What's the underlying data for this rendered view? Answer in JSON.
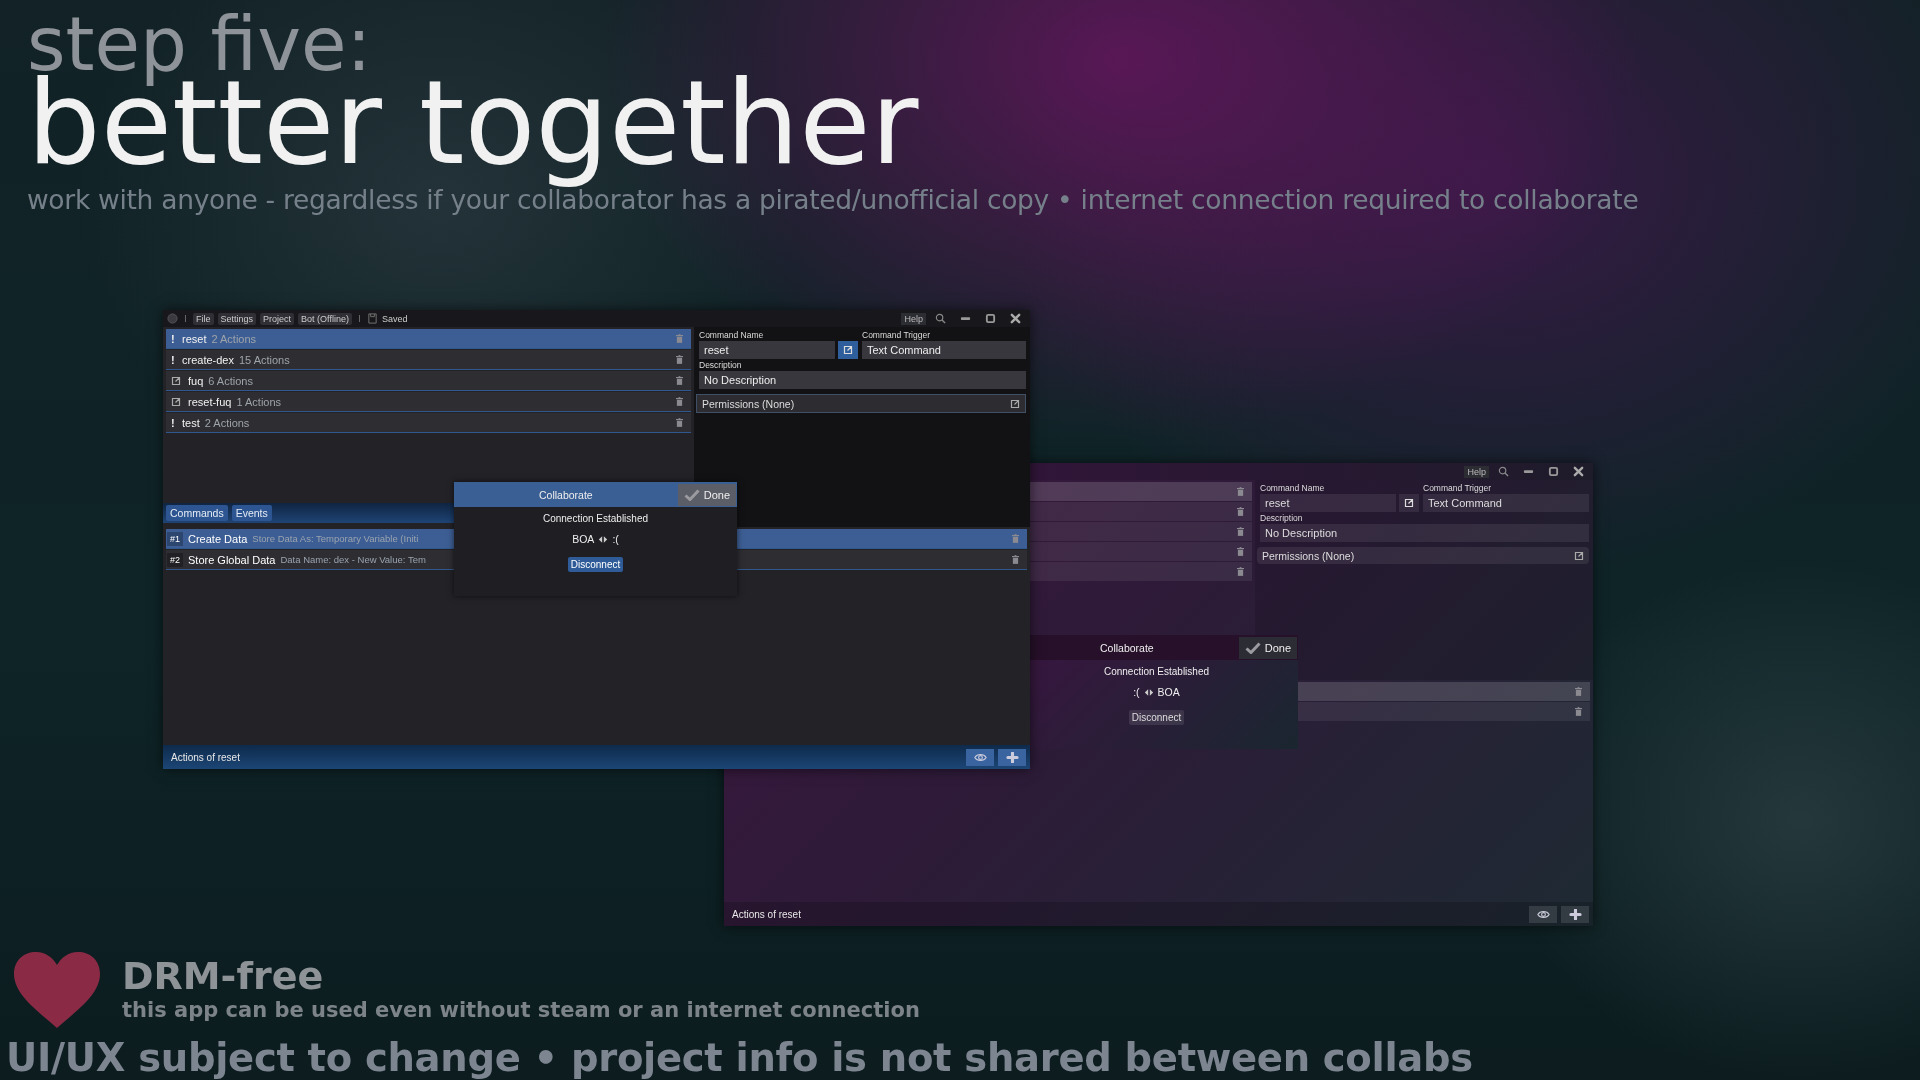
{
  "heading": {
    "kicker": "step five:",
    "title": "better together",
    "subtitle": "work with anyone - regardless if your collaborator has a pirated/unofficial copy • internet connection required to collaborate"
  },
  "windows": [
    {
      "kind": "classic",
      "menu": [
        "File",
        "Settings",
        "Project",
        "Bot (Offline)"
      ],
      "status": "Saved",
      "help": "Help",
      "commands": [
        {
          "kind": "command",
          "marker": "!",
          "name": "reset",
          "count": "2 Actions",
          "selected": true
        },
        {
          "kind": "command",
          "marker": "!",
          "name": "create-dex",
          "count": "15 Actions",
          "selected": false
        },
        {
          "kind": "event",
          "name": "fuq",
          "count": "6 Actions",
          "selected": false
        },
        {
          "kind": "event",
          "name": "reset-fuq",
          "count": "1 Actions",
          "selected": false
        },
        {
          "kind": "command",
          "marker": "!",
          "name": "test",
          "count": "2 Actions",
          "selected": false
        }
      ],
      "tabs": [
        "Commands",
        "Events"
      ],
      "form": {
        "name_label": "Command Name",
        "name": "reset",
        "trigger_label": "Command Trigger",
        "trigger": "Text Command",
        "description_label": "Description",
        "description": "No Description",
        "permissions": "Permissions (None)"
      },
      "actions": [
        {
          "number": "#1",
          "name": "Create Data",
          "detail": "Store Data As: Temporary Variable (Initi",
          "selected": true
        },
        {
          "number": "#2",
          "name": "Store Global Data",
          "detail": "Data Name: dex - New Value: Tem",
          "selected": false
        }
      ],
      "footer": "Actions of reset",
      "collab": {
        "title": "Collaborate",
        "done": "Done",
        "status": "Connection Established",
        "left": "BOA",
        "right": ":(",
        "button": "Disconnect"
      }
    },
    {
      "kind": "tinted",
      "help": "Help",
      "commands": [
        {
          "selected": true
        },
        {
          "selected": false
        },
        {
          "selected": false
        },
        {
          "selected": false
        },
        {
          "selected": false
        }
      ],
      "form": {
        "name_label": "Command Name",
        "name": "reset",
        "trigger_label": "Command Trigger",
        "trigger": "Text Command",
        "description_label": "Description",
        "description": "No Description",
        "permissions": "Permissions (None)"
      },
      "actions": [
        {
          "selected": true
        },
        {
          "selected": false
        }
      ],
      "footer": "Actions of reset",
      "collab": {
        "title": "Collaborate",
        "done": "Done",
        "status": "Connection Established",
        "left": ":(",
        "right": "BOA",
        "button": "Disconnect"
      }
    }
  ],
  "promo": {
    "title": "DRM-free",
    "text": "this app can be used even without steam or an internet connection"
  },
  "disclaimer": "UI/UX subject to change • project info is not shared between collabs"
}
